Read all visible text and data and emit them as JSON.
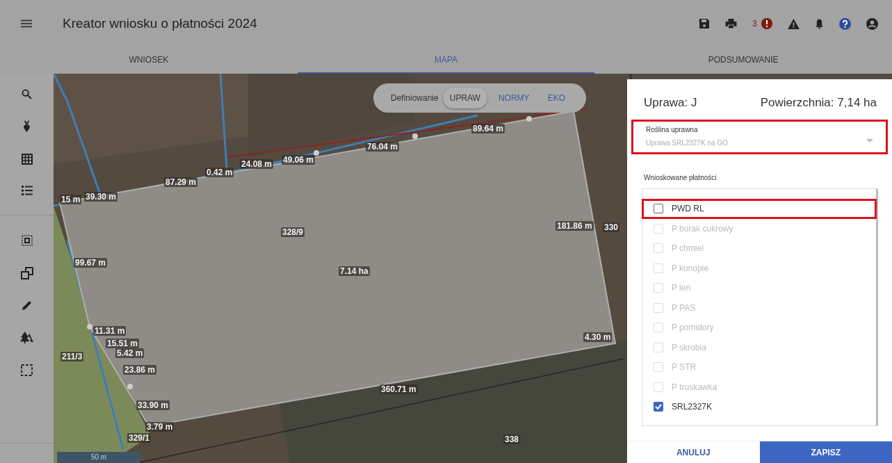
{
  "app_bar": {
    "title": "Kreator wniosku o płatności 2024",
    "error_count": "3"
  },
  "tabs": [
    {
      "label": "WNIOSEK",
      "selected": false
    },
    {
      "label": "MAPA",
      "selected": true
    },
    {
      "label": "PODSUMOWANIE",
      "selected": false
    }
  ],
  "map": {
    "mode_switch": {
      "label": "Definiowanie",
      "options": [
        {
          "label": "UPRAW",
          "selected": true
        },
        {
          "label": "NORMY",
          "selected": false
        },
        {
          "label": "EKO",
          "selected": false
        }
      ]
    },
    "labels": [
      "15 m",
      "39.30 m",
      "87.29 m",
      "0.42 m",
      "24.08 m",
      "49.06 m",
      "76.04 m",
      "89.64 m",
      "181.86 m",
      "330",
      "328/9",
      "7.14 ha",
      "99.67 m",
      "11.31 m",
      "15.51 m",
      "5.42 m",
      "23.86 m",
      "33.90 m",
      "3.79 m",
      "329/1",
      "211/3",
      "4.30 m",
      "360.71 m",
      "338"
    ],
    "scale": "50 m"
  },
  "dialog": {
    "title": "Uprawa: J",
    "area": "Powierzchnia: 7,14 ha",
    "plant_field": {
      "label": "Roślina uprawna",
      "value": "Uprawa SRL2327K na GO",
      "disabled": true,
      "highlighted": true
    },
    "payments_label": "Wnioskowane płatności",
    "payments": [
      {
        "label": "PWD RL",
        "checked": false,
        "disabled": false,
        "highlighted": true
      },
      {
        "label": "P burak cukrowy",
        "checked": false,
        "disabled": true,
        "highlighted": false
      },
      {
        "label": "P chmiel",
        "checked": false,
        "disabled": true,
        "highlighted": false
      },
      {
        "label": "P konopie",
        "checked": false,
        "disabled": true,
        "highlighted": false
      },
      {
        "label": "P len",
        "checked": false,
        "disabled": true,
        "highlighted": false
      },
      {
        "label": "P PAS",
        "checked": false,
        "disabled": true,
        "highlighted": false
      },
      {
        "label": "P pomidory",
        "checked": false,
        "disabled": true,
        "highlighted": false
      },
      {
        "label": "P skrobia",
        "checked": false,
        "disabled": true,
        "highlighted": false
      },
      {
        "label": "P STR",
        "checked": false,
        "disabled": true,
        "highlighted": false
      },
      {
        "label": "P truskawka",
        "checked": false,
        "disabled": true,
        "highlighted": false
      },
      {
        "label": "SRL2327K",
        "checked": true,
        "disabled": false,
        "highlighted": false
      }
    ],
    "buttons": [
      {
        "label": "ANULUJ",
        "kind": "secondary"
      },
      {
        "label": "ZAPISZ",
        "kind": "primary"
      }
    ]
  }
}
